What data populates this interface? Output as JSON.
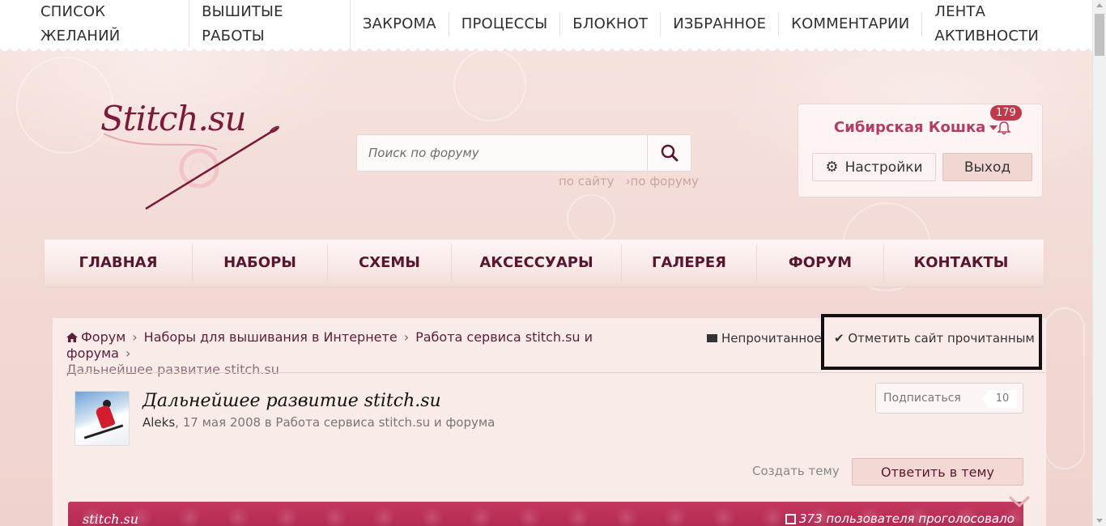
{
  "top_nav": {
    "items": [
      "СПИСОК ЖЕЛАНИЙ",
      "ВЫШИТЫЕ РАБОТЫ",
      "ЗАКРОМА",
      "ПРОЦЕССЫ",
      "БЛОКНОТ",
      "ИЗБРАННОЕ",
      "КОММЕНТАРИИ",
      "ЛЕНТА АКТИВНОСТИ"
    ]
  },
  "logo": {
    "text": "Stitch.su"
  },
  "search": {
    "placeholder": "Поиск по форуму",
    "scope_site": "по сайту",
    "scope_forum": "›по форуму"
  },
  "user": {
    "name": "Сибирская Кошка",
    "notifications": "179",
    "settings_label": "Настройки",
    "logout_label": "Выход"
  },
  "main_nav": {
    "items": [
      "ГЛАВНАЯ",
      "НАБОРЫ",
      "СХЕМЫ",
      "АКСЕССУАРЫ",
      "ГАЛЕРЕЯ",
      "ФОРУМ",
      "КОНТАКТЫ"
    ]
  },
  "breadcrumb": {
    "items": [
      "Форум",
      "Наборы для вышивания в Интернете",
      "Работа сервиса stitch.su и форума"
    ],
    "current": "Дальнейшее развитие stitch.su"
  },
  "actions": {
    "unread": "Непрочитанное",
    "mark_read": "Отметить сайт прочитанным"
  },
  "topic": {
    "title": "Дальнейшее развитие stitch.su",
    "author": "Aleks",
    "meta": ", 17 мая 2008 в Работа сервиса stitch.su и форума",
    "subscribe_label": "Подписаться",
    "subscribe_count": "10",
    "create_topic": "Создать тему",
    "reply": "Ответить в тему"
  },
  "poll": {
    "name": "stitch.su",
    "votes": "373 пользователя проголосовало"
  },
  "colors": {
    "accent": "#b43e63",
    "nav_text": "#5a1630",
    "poll_bar": "#c4385f"
  }
}
